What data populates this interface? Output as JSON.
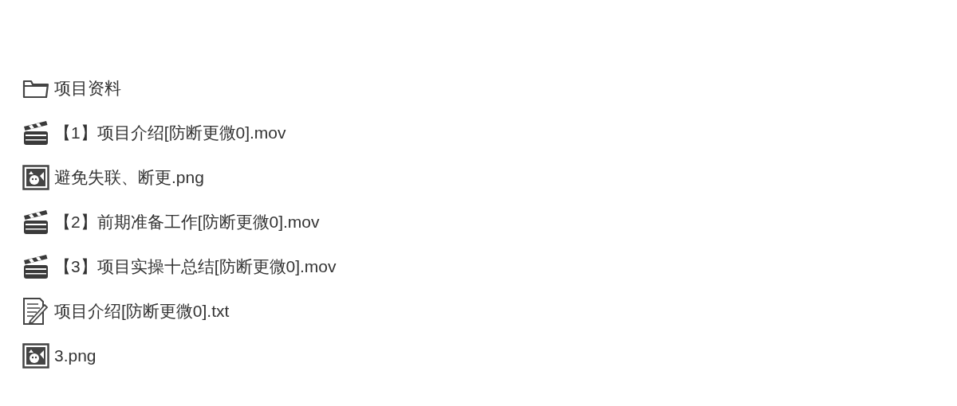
{
  "files": [
    {
      "kind": "folder",
      "name": "项目资料"
    },
    {
      "kind": "video",
      "name": "【1】项目介绍[防断更微0].mov"
    },
    {
      "kind": "image",
      "name": "避免失联、断更.png"
    },
    {
      "kind": "video",
      "name": "【2】前期准备工作[防断更微0].mov"
    },
    {
      "kind": "video",
      "name": "【3】项目实操十总结[防断更微0].mov"
    },
    {
      "kind": "text",
      "name": "项目介绍[防断更微0].txt"
    },
    {
      "kind": "image",
      "name": "3.png"
    }
  ]
}
